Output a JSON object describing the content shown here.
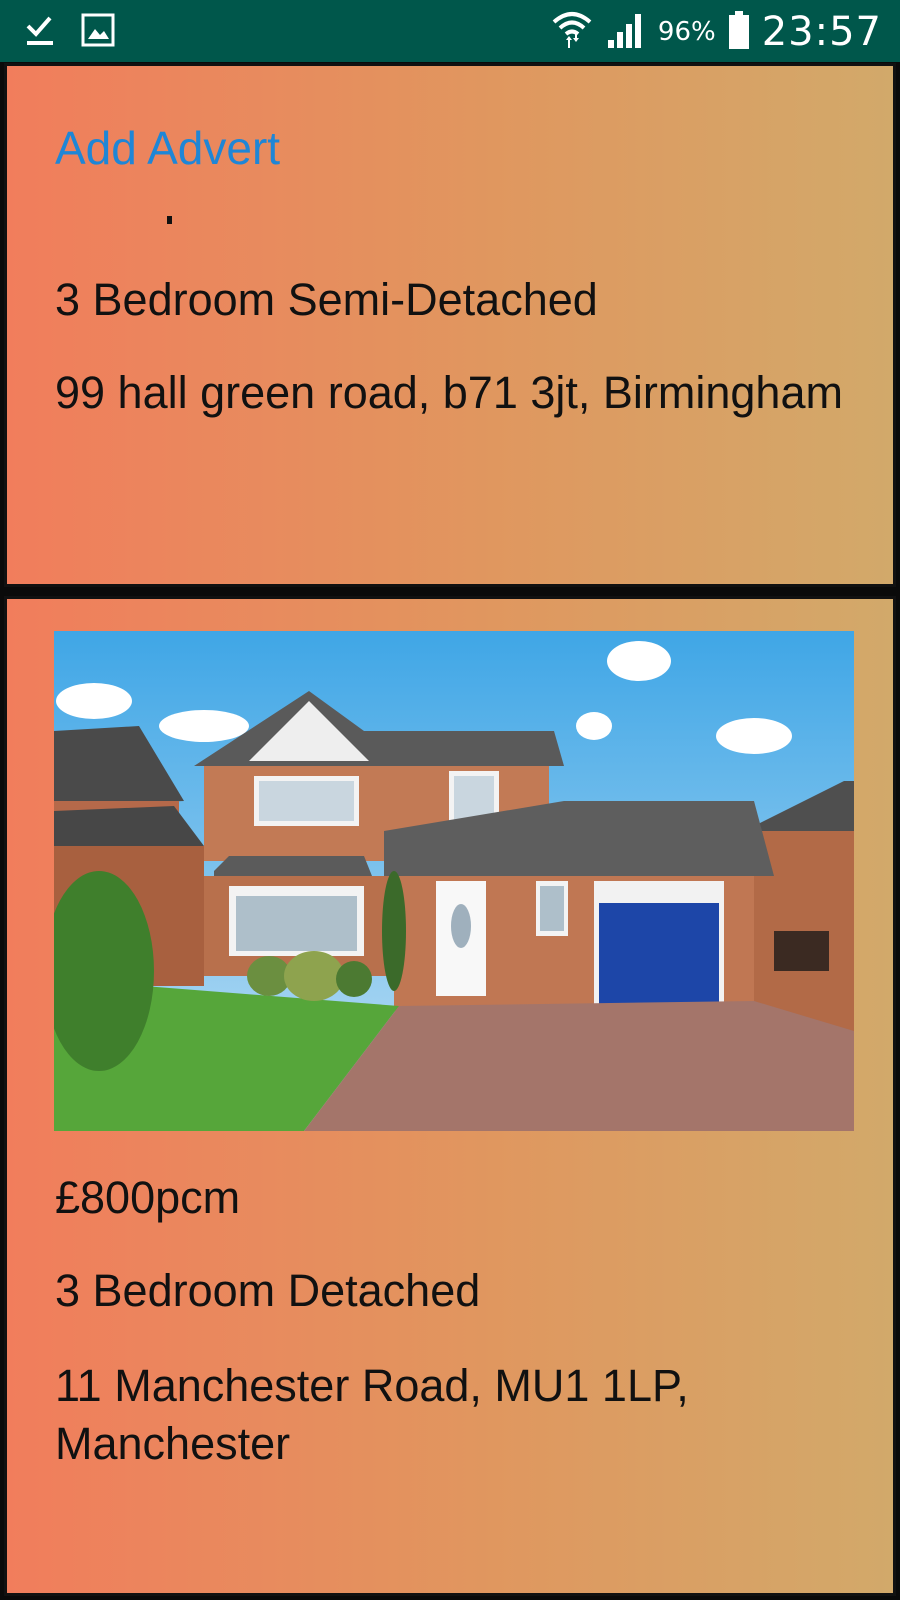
{
  "status_bar": {
    "battery_percent": "96%",
    "time": "23:57",
    "icons": [
      "check-download-icon",
      "image-icon",
      "wifi-icon",
      "signal-icon",
      "battery-icon"
    ]
  },
  "header": {
    "add_advert_label": "Add Advert"
  },
  "adverts": [
    {
      "price": "",
      "title": "3 Bedroom Semi-Detached",
      "address": "99 hall green road, b71 3jt, Birmingham"
    },
    {
      "price": "£800pcm",
      "title": "3 Bedroom Detached",
      "address": "11 Manchester Road, MU1 1LP, Manchester"
    }
  ],
  "colors": {
    "status_bar": "#00574b",
    "card_gradient_start": "#f17d5c",
    "card_gradient_end": "#d2a96a",
    "link": "#1f86d6"
  }
}
